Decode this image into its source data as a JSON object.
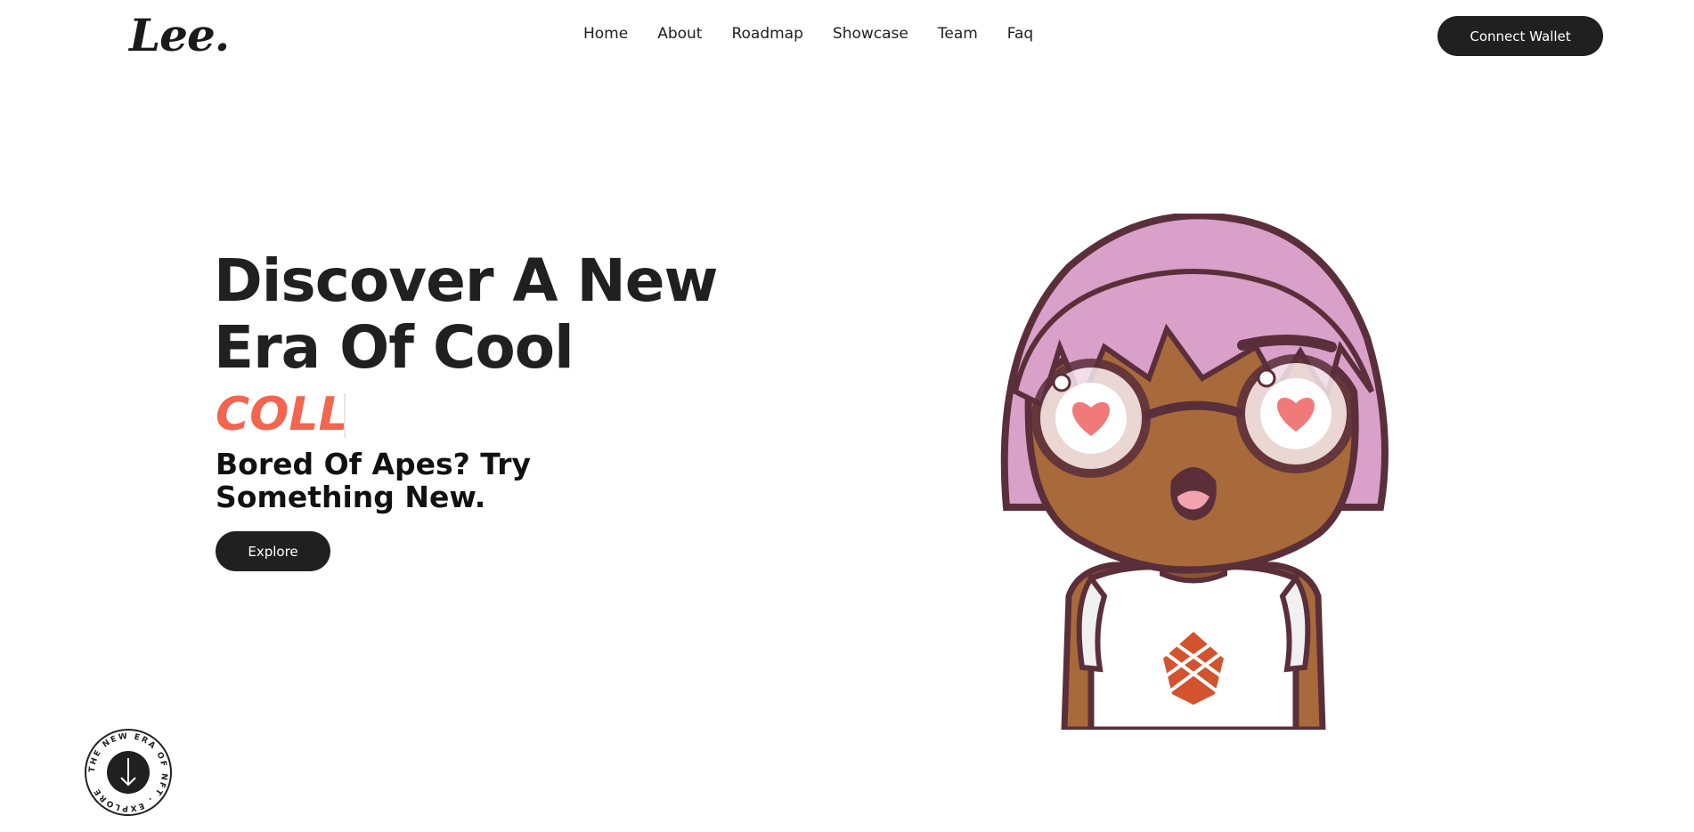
{
  "header": {
    "logo": "Lee.",
    "nav": [
      "Home",
      "About",
      "Roadmap",
      "Showcase",
      "Team",
      "Faq"
    ],
    "connect_label": "Connect Wallet"
  },
  "hero": {
    "title_line1": "Discover A New",
    "title_line2": "Era Of Cool",
    "typed_word": "COLL",
    "subtitle": "Bored Of Apes? Try Something New.",
    "explore_label": "Explore"
  },
  "badge": {
    "circular_text": "THE NEW ERA OF NFT . EXPLORE",
    "icon": "arrow-down-icon"
  },
  "colors": {
    "accent": "#f2654f",
    "dark": "#202020",
    "hair": "#d9a0c9",
    "skin": "#a86a3a",
    "outline": "#5a2f3a"
  }
}
